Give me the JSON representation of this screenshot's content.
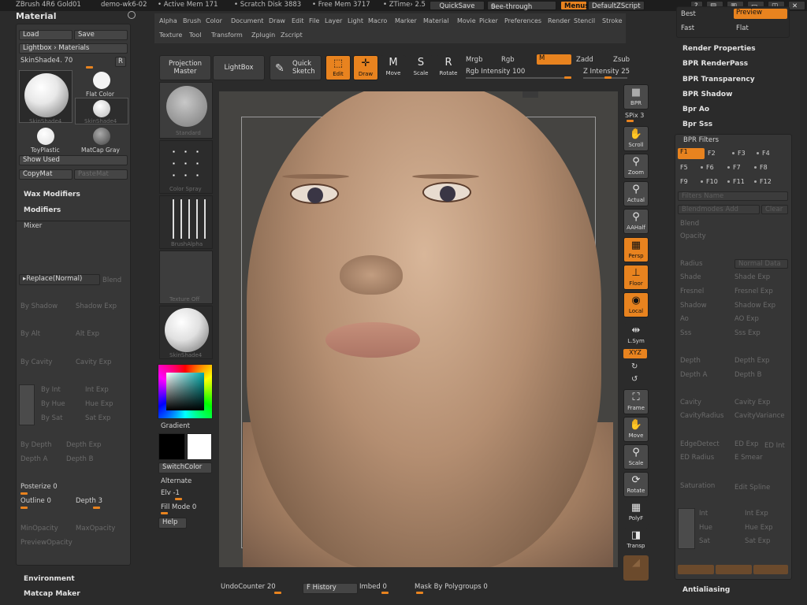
{
  "titlebar": {
    "app": "ZBrush 4R6 Gold01",
    "doc": "demo-wk6-02",
    "active_mem": "• Active Mem 171",
    "scratch": "• Scratch Disk 3883",
    "free_mem": "• Free Mem 3717",
    "ztime": "• ZTime› 2.5",
    "quicksave": "QuickSave",
    "see_through": "See-through",
    "see_through_val": "0",
    "menus": "Menus",
    "zscript": "DefaultZScript"
  },
  "menubar": {
    "row1": [
      "Alpha",
      "Brush",
      "Color",
      "Document",
      "Draw",
      "Edit",
      "File",
      "Layer",
      "Light",
      "Macro",
      "Marker",
      "Material",
      "Movie",
      "Picker",
      "Preferences",
      "Render",
      "Stencil",
      "Stroke"
    ],
    "row2": [
      "Texture",
      "Tool",
      "Transform",
      "Zplugin",
      "Zscript"
    ]
  },
  "left": {
    "title": "Material",
    "load": "Load",
    "save": "Save",
    "lightbox": "Lightbox › Materials",
    "current": "SkinShade4. 70",
    "r": "R",
    "thumbs": [
      "SkinShade4",
      "Flat Color",
      "SkinShade4",
      "ToyPlastic",
      "MatCap Gray"
    ],
    "show_used": "Show Used",
    "copymat": "CopyMat",
    "pastemat": "PasteMat",
    "wax": "Wax Modifiers",
    "modifiers": "Modifiers",
    "mixer": "Mixer",
    "replace": "Replace(Normal)",
    "blend": "Blend",
    "dim_labels": [
      "By Shadow",
      "Shadow Exp",
      "By Alt",
      "Alt Exp",
      "By Cavity",
      "Cavity Exp",
      "By Int",
      "Int Exp",
      "By Hue",
      "Hue Exp",
      "By Sat",
      "Sat Exp",
      "By Depth",
      "Depth Exp",
      "Depth A",
      "Depth B",
      "MinOpacity",
      "MaxOpacity",
      "PreviewOpacity"
    ],
    "posterize": "Posterize 0",
    "outline": "Outline 0",
    "depth": "Depth 3",
    "environment": "Environment",
    "matcap_maker": "Matcap Maker"
  },
  "shelf": {
    "projection": "Projection Master",
    "lightbox": "LightBox",
    "quick_sketch": "Quick Sketch",
    "edit": "Edit",
    "draw": "Draw",
    "move": "Move",
    "scale": "Scale",
    "rotate": "Rotate",
    "mrgb": "Mrgb",
    "rgb": "Rgb",
    "m": "M",
    "zadd": "Zadd",
    "zsub": "Zsub",
    "rgb_intensity": "Rgb Intensity 100",
    "z_intensity": "Z Intensity 25"
  },
  "palette": {
    "items": [
      "Standard",
      "Color Spray",
      "BrushAlpha",
      "Texture Off",
      "SkinShade4"
    ],
    "gradient": "Gradient",
    "switchcolor": "SwitchColor",
    "alternate": "Alternate",
    "elv": "Elv -1",
    "fill_mode": "Fill Mode 0",
    "help": "Help"
  },
  "tools": {
    "bpr": "BPR",
    "spix": "SPix 3",
    "scroll": "Scroll",
    "zoom": "Zoom",
    "actual": "Actual",
    "aahalf": "AAHalf",
    "persp": "Persp",
    "floor": "Floor",
    "local": "Local",
    "lsym": "L.Sym",
    "xyz": "XYZ",
    "frame": "Frame",
    "move": "Move",
    "scale": "Scale",
    "rotate": "Rotate",
    "polyf": "PolyF",
    "transp": "Transp"
  },
  "right": {
    "best": "Best",
    "preview": "Preview",
    "fast": "Fast",
    "flat": "Flat",
    "items": [
      "Render Properties",
      "BPR RenderPass",
      "BPR Transparency",
      "BPR Shadow",
      "Bpr Ao",
      "Bpr Sss"
    ],
    "filters": "BPR Filters",
    "fkeys": [
      "F1",
      "F2",
      "F3",
      "F4",
      "F5",
      "F6",
      "F7",
      "F8",
      "F9",
      "F10",
      "F11",
      "F12"
    ],
    "dim": [
      "Filters Name",
      "Blendmodes Add",
      "Clear",
      "Blend",
      "Opacity",
      "Radius",
      "Normal Data",
      "Shade",
      "Shade Exp",
      "Fresnel",
      "Fresnel Exp",
      "Shadow",
      "Shadow Exp",
      "Ao",
      "AO Exp",
      "Sss",
      "Sss Exp",
      "Depth",
      "Depth Exp",
      "Depth A",
      "Depth B",
      "Cavity",
      "Cavity Exp",
      "CavityRadius",
      "CavityVariance",
      "EdgeDetect",
      "ED Exp",
      "ED Int",
      "ED Radius",
      "E Smear",
      "Saturation",
      "Edit Spline",
      "Int",
      "Int Exp",
      "Hue",
      "Hue Exp",
      "Sat",
      "Sat Exp"
    ],
    "antialiasing": "Antialiasing"
  },
  "bottom": {
    "undo": "UndoCounter 20",
    "history": "F History",
    "imbed": "Imbed 0",
    "mask": "Mask By Polygroups 0"
  },
  "colors": {
    "accent": "#e8831f",
    "panel": "#373737",
    "bg": "#2b2b2b"
  }
}
